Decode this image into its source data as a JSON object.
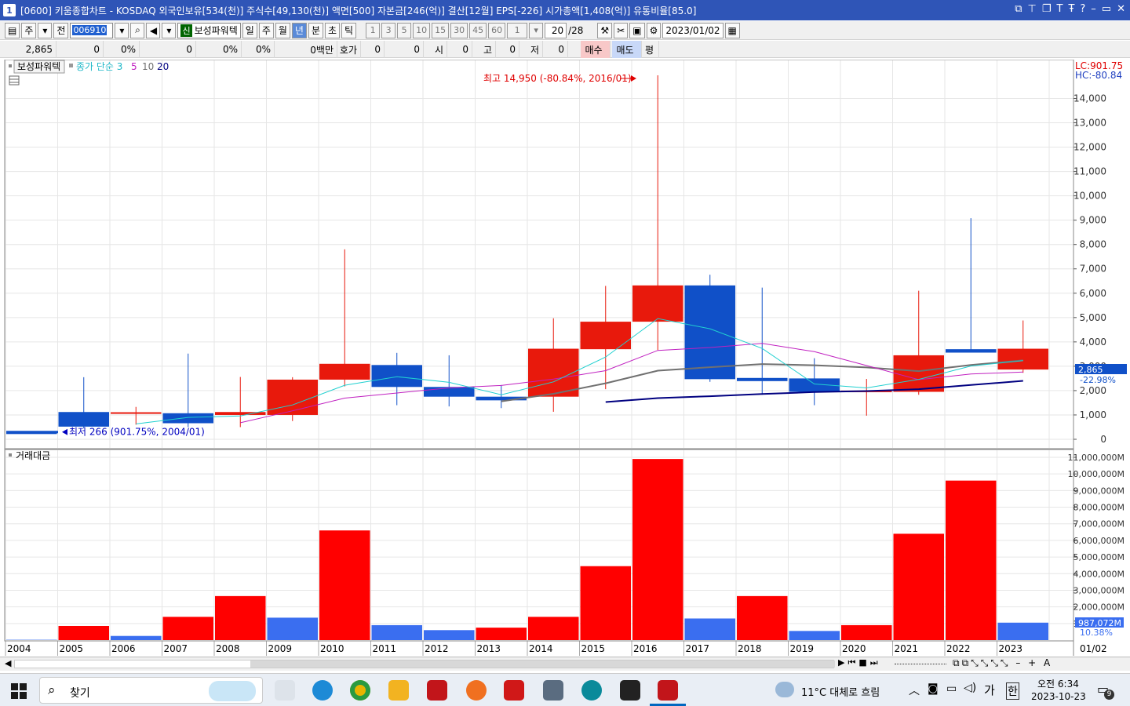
{
  "window": {
    "title_index": "1",
    "title": "[0600] 키움종합차트 - KOSDAQ 외국인보유[534(천)] 주식수[49,130(천)] 액면[500] 자본금[246(억)] 결산[12월] EPS[-226] 시가총액[1,408(억)] 유통비율[85.0]"
  },
  "toolbar": {
    "mode_label": "주",
    "prev_label": "전",
    "code": "006910",
    "new_label": "신",
    "stock_name": "보성파워텍",
    "periods": [
      "일",
      "주",
      "월",
      "년",
      "분",
      "초",
      "틱"
    ],
    "selected_period": "년",
    "intervals": [
      "1",
      "3",
      "5",
      "10",
      "15",
      "30",
      "45",
      "60"
    ],
    "interval_value": "1",
    "count": "20",
    "count_total": "/28",
    "date": "2023/01/02"
  },
  "quote_row": {
    "price": "2,865",
    "change": "0",
    "change_pct": "0%",
    "volume": "0",
    "volume_pct": "0%",
    "vol_ratio": "0%",
    "amount": "0백만",
    "hoga_label": "호가",
    "hoga_val1": "0",
    "hoga_val2": "0",
    "open_label": "시",
    "open_val": "0",
    "high_label": "고",
    "high_val": "0",
    "low_label": "저",
    "low_val": "0",
    "buy_label": "매수",
    "sell_label": "매도",
    "avg_label": "평"
  },
  "status": {
    "right_date": "01/02"
  },
  "taskbar": {
    "search_label": "찾기",
    "weather": "11°C 대체로 흐림",
    "ime_label": "가",
    "lang_label": "한",
    "time": "오전 6:34",
    "date": "2023-10-23",
    "notification_count": "9"
  },
  "colors": {
    "up": "#e8190c",
    "down": "#1050c8",
    "vol_up": "#ff0000",
    "vol_down": "#3a6ef0",
    "ma3": "#20d0d0",
    "ma5": "#c020c0",
    "ma10": "#707070",
    "ma20": "#000080"
  },
  "chart_data": [
    {
      "type": "candlestick",
      "panel_title": "보성파워텍",
      "legend": [
        {
          "label": "종가 단순 3",
          "color": "#20d0d0"
        },
        {
          "label": "5",
          "color": "#c020c0"
        },
        {
          "label": "10",
          "color": "#707070"
        },
        {
          "label": "20",
          "color": "#000080"
        }
      ],
      "ylim": [
        0,
        14950
      ],
      "yticks": [
        0,
        1000,
        2000,
        3000,
        4000,
        5000,
        6000,
        7000,
        8000,
        9000,
        10000,
        11000,
        12000,
        13000,
        14000
      ],
      "ytick_labels": [
        "0",
        "1,000",
        "2,000",
        "3,000",
        "4,000",
        "5,000",
        "6,000",
        "7,000",
        "8,000",
        "9,000",
        "10,000",
        "11,000",
        "12,000",
        "13,000",
        "14,000"
      ],
      "x": [
        "2004",
        "2005",
        "2006",
        "2007",
        "2008",
        "2009",
        "2010",
        "2011",
        "2012",
        "2013",
        "2014",
        "2015",
        "2016",
        "2017",
        "2018",
        "2019",
        "2020",
        "2021",
        "2022",
        "2023"
      ],
      "open": [
        280,
        1120,
        1050,
        1070,
        1000,
        1000,
        2450,
        3050,
        2150,
        1750,
        1750,
        3700,
        4830,
        6320,
        2520,
        2500,
        1950,
        1950,
        3700,
        2865
      ],
      "high": [
        330,
        2550,
        1330,
        3520,
        2560,
        2550,
        7800,
        3550,
        3450,
        2230,
        4970,
        6300,
        14950,
        6760,
        6230,
        3330,
        2480,
        6100,
        9080,
        4880
      ],
      "low": [
        266,
        450,
        600,
        500,
        500,
        750,
        2170,
        1400,
        1350,
        1280,
        1130,
        2060,
        3670,
        2360,
        1830,
        1400,
        970,
        1830,
        3620,
        2730
      ],
      "close": [
        266,
        520,
        1110,
        660,
        1120,
        2450,
        3100,
        2150,
        1750,
        1600,
        3720,
        4830,
        6320,
        2470,
        2390,
        1950,
        2000,
        3450,
        3560,
        3720
      ],
      "ma3": [
        null,
        null,
        630,
        900,
        960,
        1410,
        2220,
        2570,
        2340,
        1830,
        2360,
        3380,
        4960,
        4540,
        3730,
        2270,
        2110,
        2460,
        3010,
        3230
      ],
      "ma5": [
        null,
        null,
        null,
        null,
        680,
        1170,
        1690,
        1900,
        2110,
        2210,
        2470,
        2820,
        3650,
        3770,
        3940,
        3600,
        3030,
        2450,
        2680,
        2760
      ],
      "ma10": [
        null,
        null,
        null,
        null,
        null,
        null,
        null,
        null,
        null,
        1560,
        1870,
        2300,
        2820,
        2960,
        3090,
        3040,
        2950,
        2800,
        3050,
        3240
      ],
      "ma20": [
        null,
        null,
        null,
        null,
        null,
        null,
        null,
        null,
        null,
        null,
        null,
        1530,
        1690,
        1770,
        1860,
        1940,
        1980,
        2060,
        2230,
        2400
      ],
      "annotations": [
        {
          "text": "최고 14,950 (-80.84%, 2016/01)",
          "x": "2016",
          "y": 14950,
          "color": "#e00000"
        },
        {
          "text": "최저 266 (901.75%, 2004/01)",
          "x": "2004",
          "y": 266,
          "color": "#0000c0"
        }
      ],
      "side_labels": {
        "lc": "LC:901.75",
        "hc": "HC:-80.84",
        "last_price": "2,865",
        "last_pct": "-22.98%"
      }
    },
    {
      "type": "bar",
      "panel_title": "거래대금",
      "x": [
        "2004",
        "2005",
        "2006",
        "2007",
        "2008",
        "2009",
        "2010",
        "2011",
        "2012",
        "2013",
        "2014",
        "2015",
        "2016",
        "2017",
        "2018",
        "2019",
        "2020",
        "2021",
        "2022",
        "2023"
      ],
      "values": [
        20,
        850,
        250,
        1400,
        2650,
        1350,
        6600,
        900,
        600,
        750,
        1400,
        4450,
        10900,
        1300,
        2650,
        550,
        900,
        6400,
        9600,
        1050
      ],
      "direction": [
        "down",
        "up",
        "down",
        "up",
        "up",
        "down",
        "up",
        "down",
        "down",
        "up",
        "up",
        "up",
        "up",
        "down",
        "up",
        "down",
        "up",
        "up",
        "up",
        "down"
      ],
      "ylim": [
        0,
        11000
      ],
      "yticks": [
        1000,
        2000,
        3000,
        4000,
        5000,
        6000,
        7000,
        8000,
        9000,
        10000,
        11000
      ],
      "ytick_labels": [
        "1,000,000M",
        "2,000,000M",
        "3,000,000M",
        "4,000,000M",
        "5,000,000M",
        "6,000,000M",
        "7,000,000M",
        "8,000,000M",
        "9,000,000M",
        "10,000,000M",
        "11,000,000M"
      ],
      "side_labels": {
        "last_value": "987,072M",
        "last_pct": "10.38%"
      }
    }
  ]
}
